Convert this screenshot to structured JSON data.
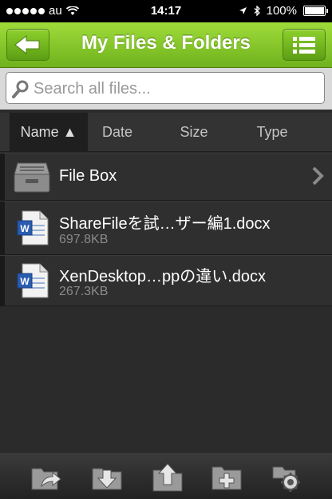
{
  "status": {
    "carrier": "au",
    "time": "14:17",
    "battery": "100%"
  },
  "nav": {
    "title": "My Files & Folders",
    "back_icon": "back-arrow-icon",
    "menu_icon": "list-menu-icon"
  },
  "search": {
    "placeholder": "Search all files..."
  },
  "sort_tabs": [
    {
      "label": "Name ▲",
      "active": true
    },
    {
      "label": "Date",
      "active": false
    },
    {
      "label": "Size",
      "active": false
    },
    {
      "label": "Type",
      "active": false
    }
  ],
  "items": [
    {
      "name": "File Box",
      "type": "folder",
      "icon": "file-box-icon"
    },
    {
      "name": "ShareFileを試…ザー編1.docx",
      "size": "697.8KB",
      "type": "docx",
      "icon": "word-doc-icon"
    },
    {
      "name": "XenDesktop…ppの違い.docx",
      "size": "267.3KB",
      "type": "docx",
      "icon": "word-doc-icon"
    }
  ],
  "toolbar": [
    "share-icon",
    "download-icon",
    "upload-icon",
    "new-folder-icon",
    "settings-icon"
  ]
}
